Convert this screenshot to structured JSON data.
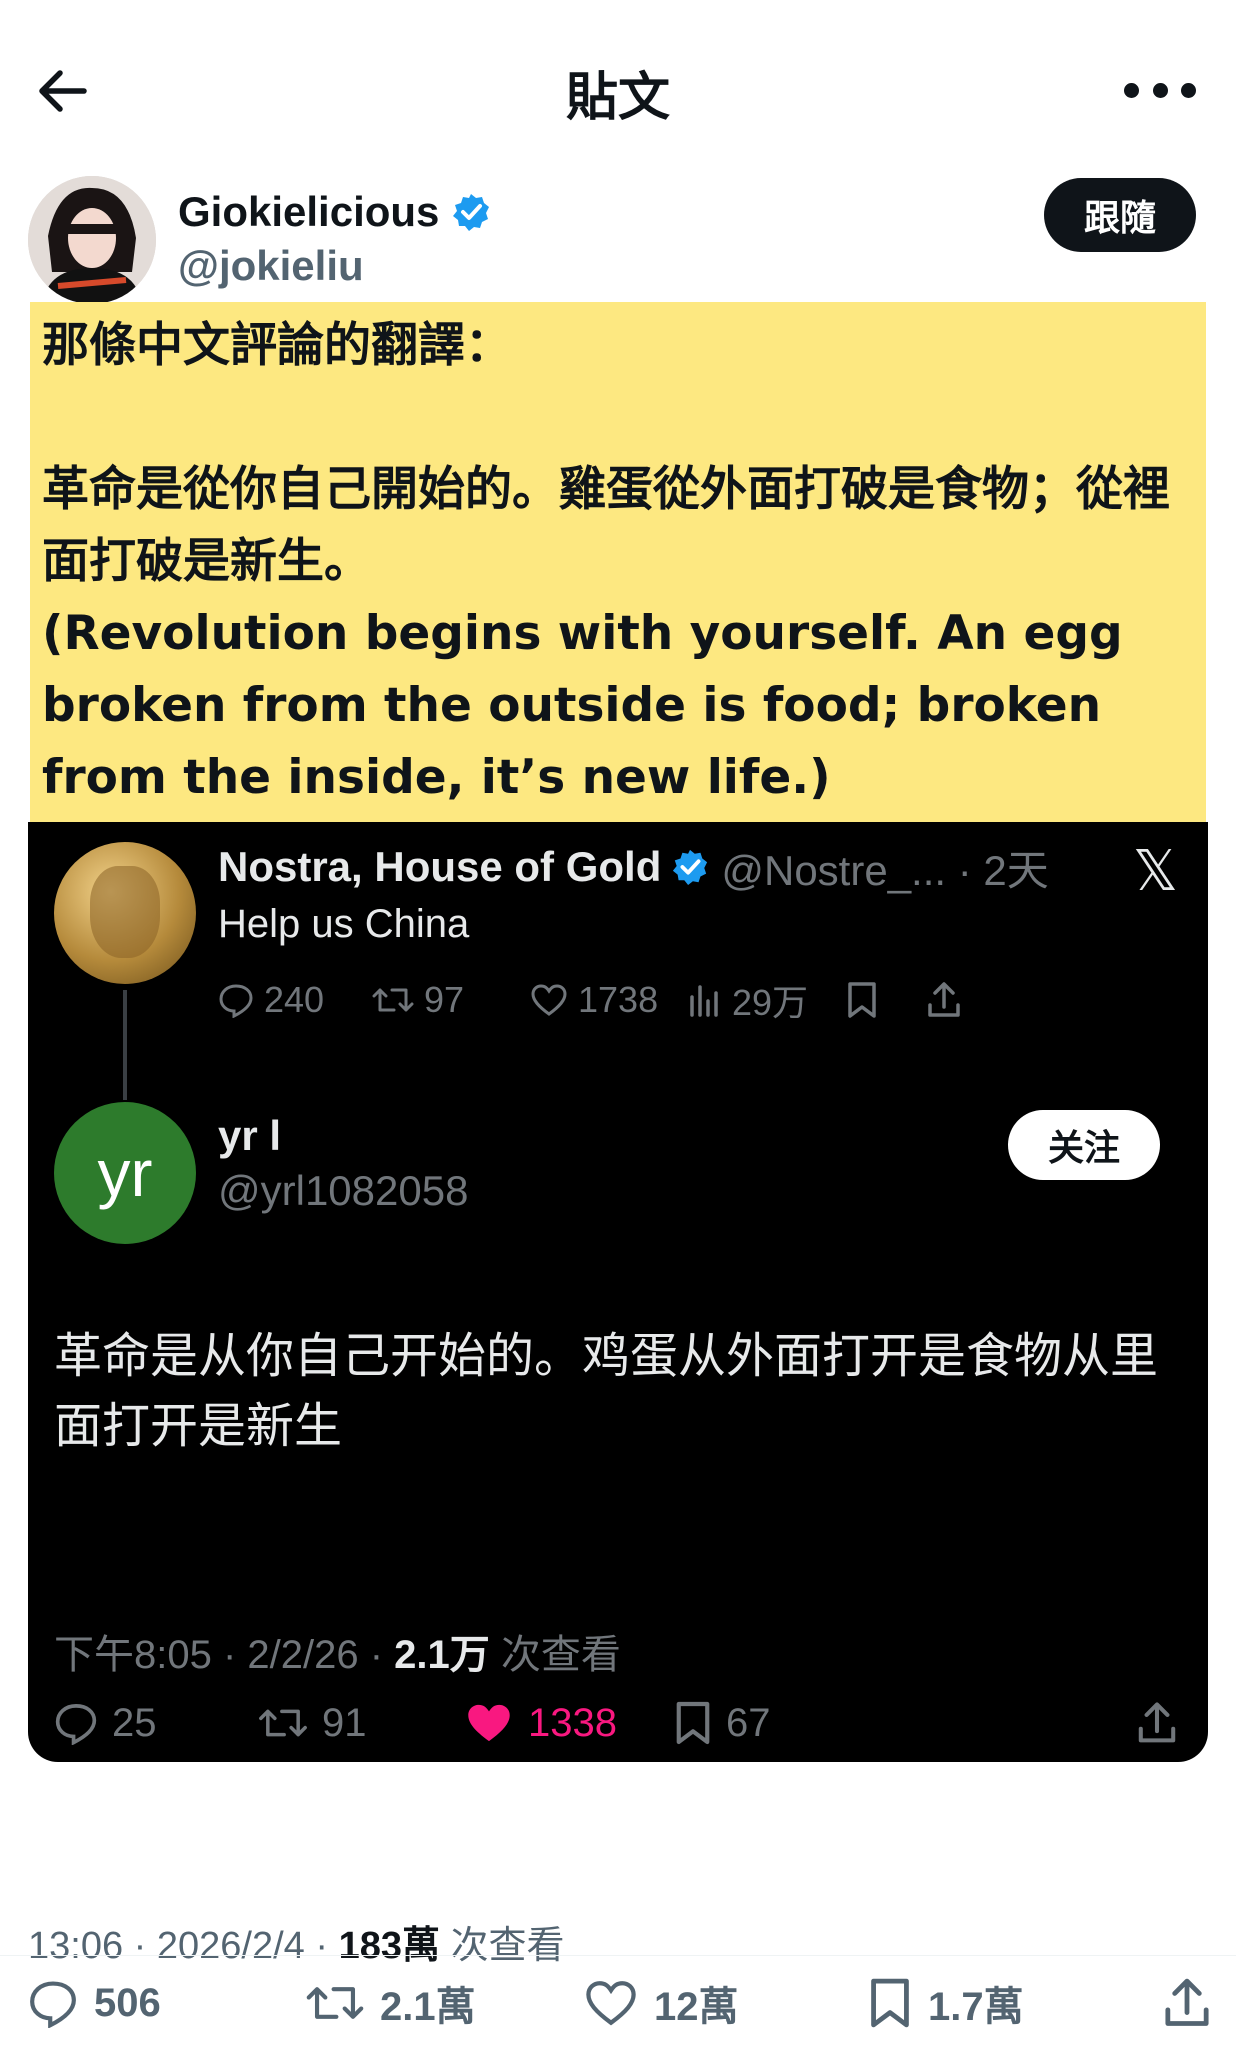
{
  "header": {
    "title": "貼文",
    "back_icon": "arrow-left-icon",
    "more_icon": "more-horizontal-icon"
  },
  "author": {
    "name": "Giokielicious",
    "handle": "@jokieliu",
    "verified": true,
    "follow_label": "跟隨"
  },
  "note": {
    "text": "那條中文評論的翻譯：\n\n革命是從你自己開始的。雞蛋從外面打破是食物；從裡面打破是新生。\n(Revolution begins with yourself. An egg broken from the outside is food; broken from the inside, it’s new life.)"
  },
  "embed": {
    "quoted": {
      "name": "Nostra, House of Gold",
      "handle_time": "@Nostre_... · 2天",
      "text": "Help us China",
      "replies": "240",
      "reposts": "97",
      "likes": "1738",
      "views": "29万"
    },
    "reply": {
      "avatar_text": "yr",
      "name": "yr l",
      "handle": "@yrl1082058",
      "follow_label": "关注",
      "text": "革命是从你自己开始的。鸡蛋从外面打开是食物从里面打开是新生",
      "time": "下午8:05 · 2/2/26 · ",
      "views_count": "2.1万",
      "views_label": " 次查看",
      "replies": "25",
      "reposts": "91",
      "likes": "1338",
      "bookmarks": "67"
    }
  },
  "post": {
    "time": "13:06 · 2026/2/4 · ",
    "views_count": "183萬",
    "views_label": " 次查看",
    "replies": "506",
    "reposts": "2.1萬",
    "likes": "12萬",
    "bookmarks": "1.7萬"
  },
  "colors": {
    "note_bg": "#fde881",
    "like_pink": "#f91880",
    "verified_blue": "#1d9bf0",
    "follow_bg": "#0f1419"
  }
}
